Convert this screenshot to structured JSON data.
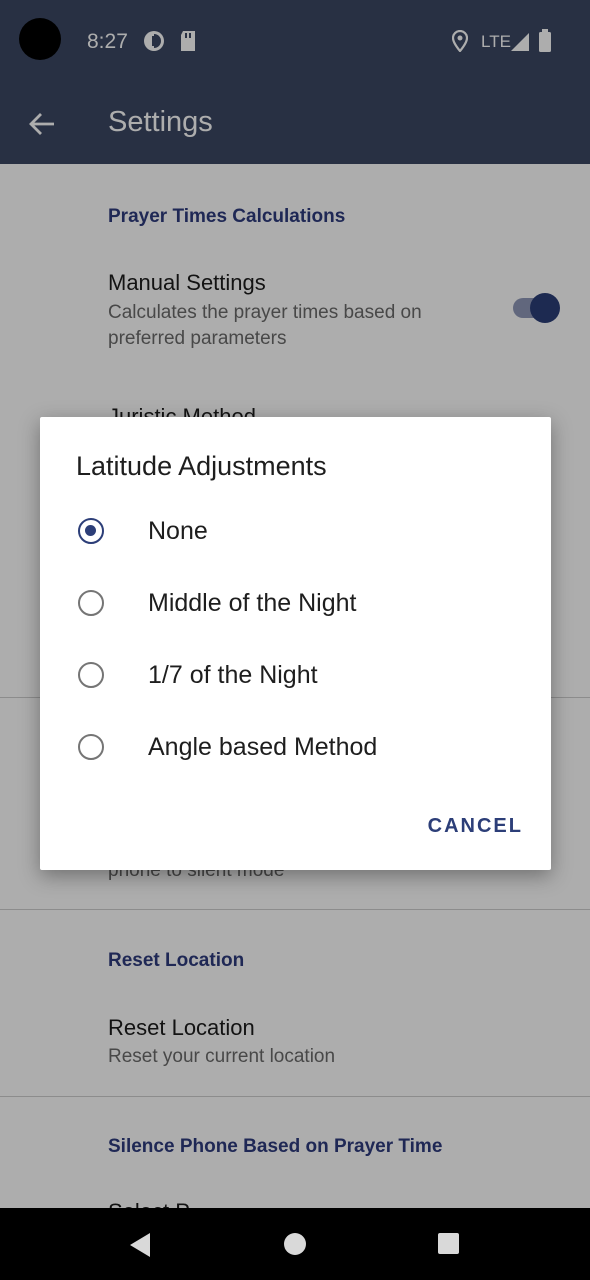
{
  "status_bar": {
    "time": "8:27",
    "network": "LTE"
  },
  "app_bar": {
    "title": "Settings"
  },
  "settings": {
    "prayer_section_header": "Prayer Times Calculations",
    "manual_title": "Manual Settings",
    "manual_subtitle": "Calculates the prayer times based on preferred parameters",
    "manual_enabled": true,
    "juristic_title": "Juristic Method",
    "silent_partial": "phone to silent mode",
    "reset_section_header": "Reset Location",
    "reset_title": "Reset Location",
    "reset_subtitle": "Reset your current location",
    "silence_section_header": "Silence Phone Based on Prayer Time",
    "select_partial": "Select P"
  },
  "dialog": {
    "title": "Latitude Adjustments",
    "options": [
      {
        "label": "None",
        "selected": true
      },
      {
        "label": "Middle of the Night",
        "selected": false
      },
      {
        "label": "1/7 of the Night",
        "selected": false
      },
      {
        "label": "Angle based Method",
        "selected": false
      }
    ],
    "cancel_label": "CANCEL"
  },
  "colors": {
    "primary": "#3b4763",
    "accent": "#2c3e78"
  }
}
